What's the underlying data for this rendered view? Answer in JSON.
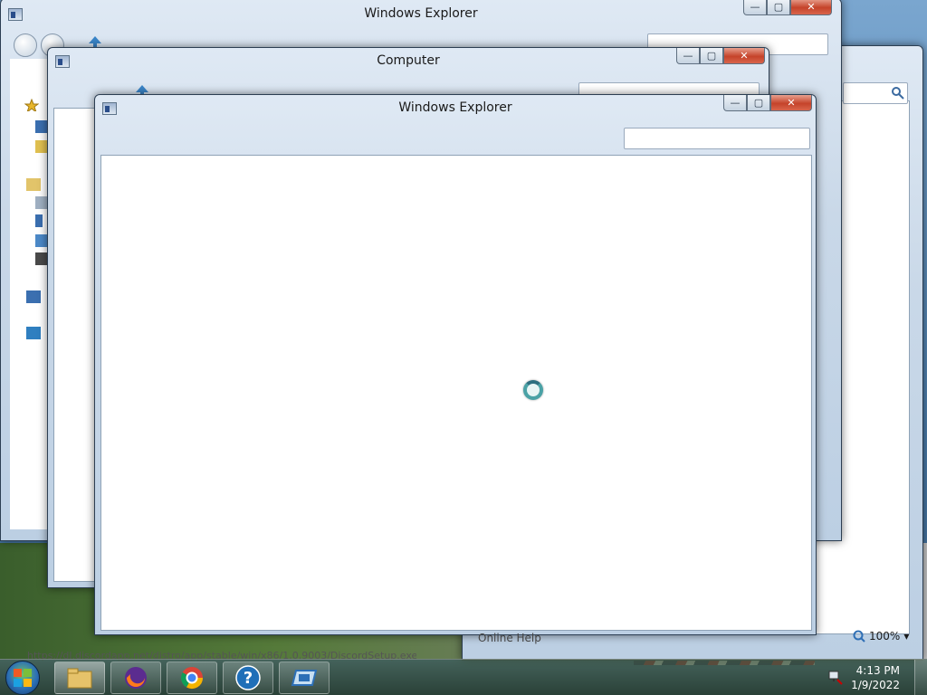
{
  "windows": {
    "back_explorer": {
      "title": "Windows Explorer"
    },
    "computer": {
      "title": "Computer"
    },
    "front_explorer": {
      "title": "Windows Explorer"
    }
  },
  "caption_buttons": {
    "minimize": "—",
    "maximize": "▢",
    "close": "✕"
  },
  "right_pane": {
    "zoom_level": "100%",
    "online_help_label": "Online Help",
    "status_url": "https://dl.discordapp.net/distro/app/stable/win/x86/1.0.9003/DiscordSetup.exe"
  },
  "taskbar": {
    "clock_time": "4:13 PM",
    "clock_date": "1/9/2022",
    "help_glyph": "?",
    "pinned": [
      "explorer",
      "firefox",
      "chrome",
      "help",
      "app"
    ]
  },
  "colors": {
    "accent_blue": "#2c6fb6",
    "close_red": "#c5432a",
    "spinner": "#4aa2a6"
  }
}
